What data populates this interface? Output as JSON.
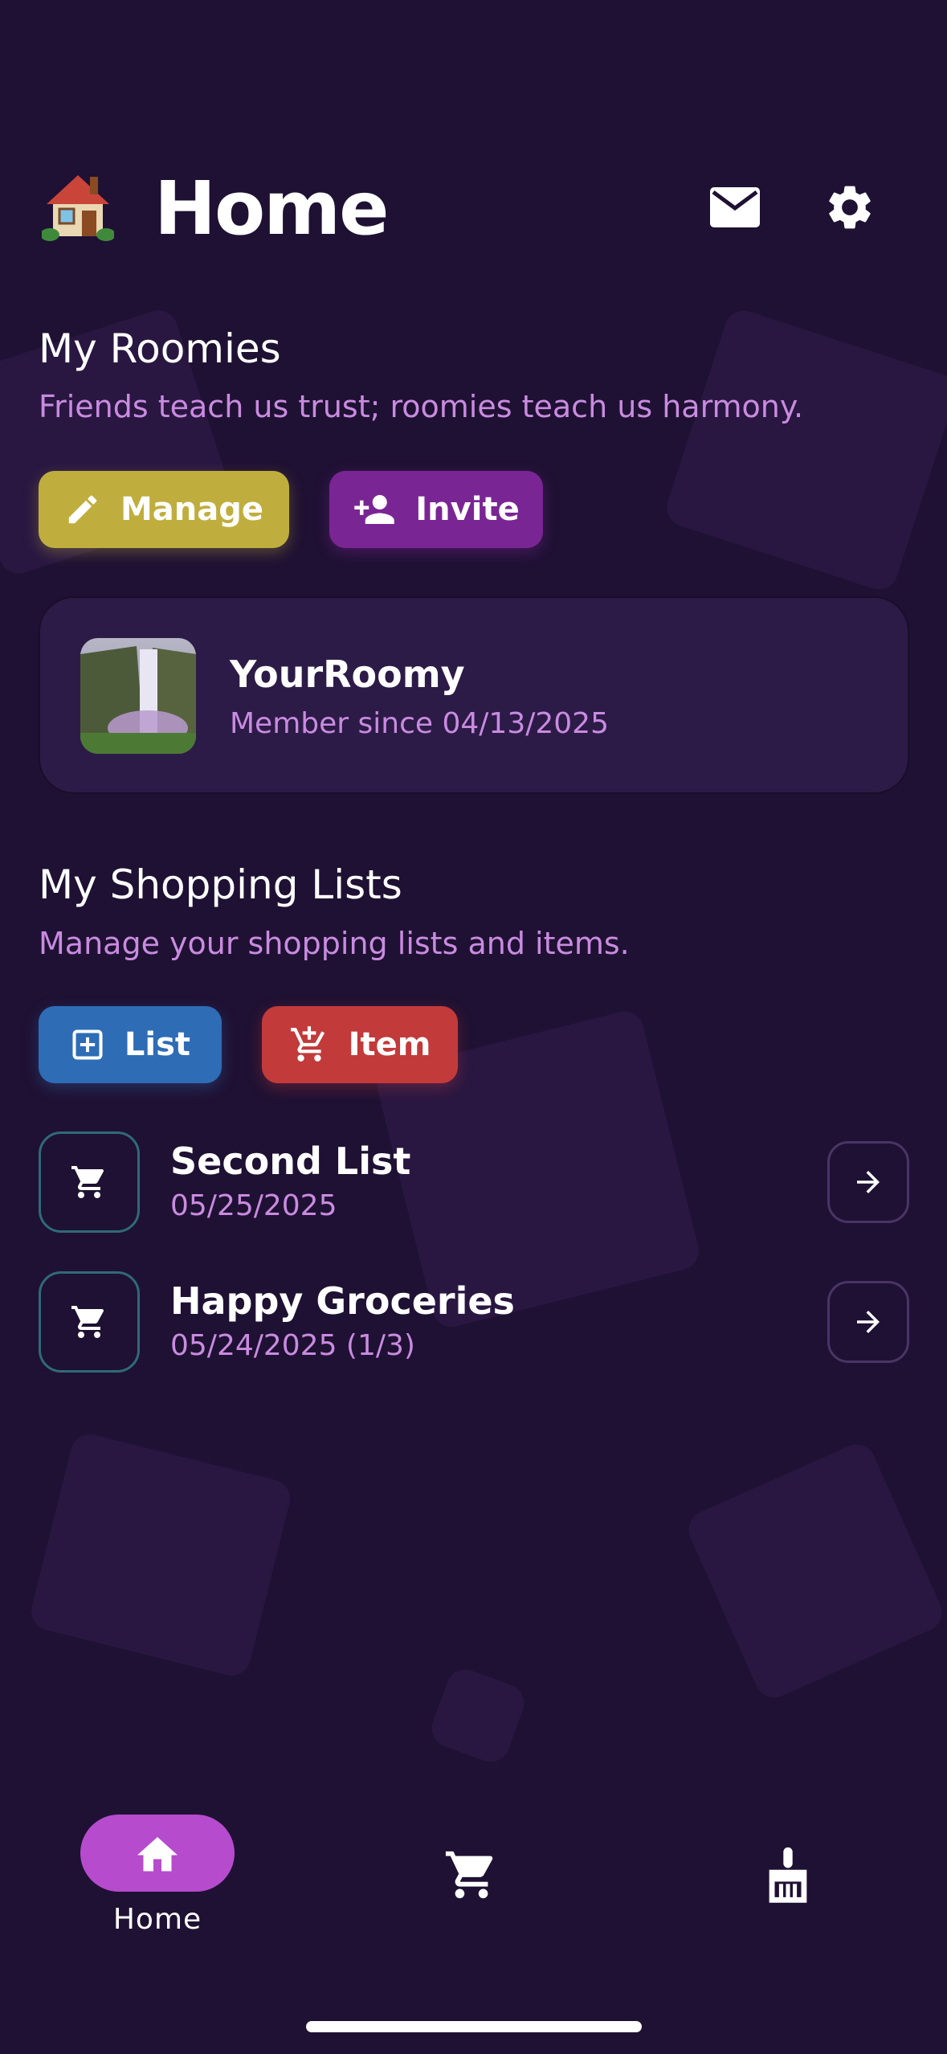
{
  "header": {
    "emoji": "🏠",
    "title": "Home",
    "icons": [
      "mail-icon",
      "gear-icon"
    ]
  },
  "roomies": {
    "title": "My Roomies",
    "subtitle": "Friends teach us trust; roomies teach us harmony.",
    "manage_label": "Manage",
    "invite_label": "Invite",
    "member": {
      "name": "YourRoomy",
      "since": "Member since 04/13/2025"
    }
  },
  "shopping": {
    "title": "My Shopping Lists",
    "subtitle": "Manage your shopping lists and items.",
    "list_button_label": "List",
    "item_button_label": "Item",
    "lists": [
      {
        "name": "Second List",
        "date": "05/25/2025"
      },
      {
        "name": "Happy Groceries",
        "date": "05/24/2025 (1/3)"
      }
    ]
  },
  "nav": {
    "items": [
      {
        "label": "Home",
        "icon": "home-icon",
        "active": true
      },
      {
        "label": "",
        "icon": "cart-icon",
        "active": false
      },
      {
        "label": "",
        "icon": "broom-icon",
        "active": false
      }
    ]
  },
  "colors": {
    "background": "#1f1133",
    "accent_purple": "#b64bcd",
    "manage_yellow": "#bfae3d",
    "invite_purple": "#7a2594",
    "list_blue": "#2e6cb5",
    "item_red": "#c23a3a",
    "subtitle_pink": "#c98be0"
  }
}
